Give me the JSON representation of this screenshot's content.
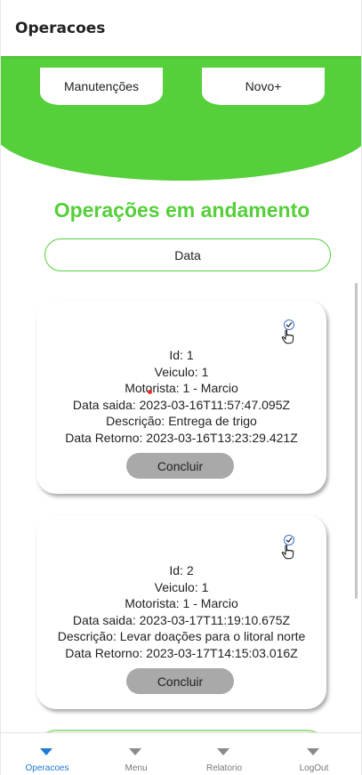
{
  "header": {
    "title": "Operacoes"
  },
  "top_buttons": {
    "maintenance": "Manutenções",
    "new": "Novo+"
  },
  "section_title": "Operações em andamento",
  "filter": {
    "label": "Data"
  },
  "colors": {
    "accent": "#55cf3a",
    "active_tab": "#1e7ad6",
    "button_gray": "#a9a9a9"
  },
  "operations": [
    {
      "id": "Id: 1",
      "vehicle": "Veiculo: 1",
      "driver": "Motorista: 1 - Marcio",
      "departure": "Data saida: 2023-03-16T11:57:47.095Z",
      "description": "Descrição: Entrega de trigo",
      "return": "Data Retorno: 2023-03-16T13:23:29.421Z",
      "action": "Concluir",
      "icon": "check-circle-icon"
    },
    {
      "id": "Id: 2",
      "vehicle": "Veiculo: 1",
      "driver": "Motorista: 1 - Marcio",
      "departure": "Data saida: 2023-03-17T11:19:10.675Z",
      "description": "Descrição: Levar doações para o litoral norte",
      "return": "Data Retorno: 2023-03-17T14:15:03.016Z",
      "action": "Concluir",
      "icon": "check-circle-icon"
    }
  ],
  "bottom_nav": [
    {
      "label": "Operacoes",
      "active": true
    },
    {
      "label": "Menu",
      "active": false
    },
    {
      "label": "Relatorio",
      "active": false
    },
    {
      "label": "LogOut",
      "active": false
    }
  ]
}
